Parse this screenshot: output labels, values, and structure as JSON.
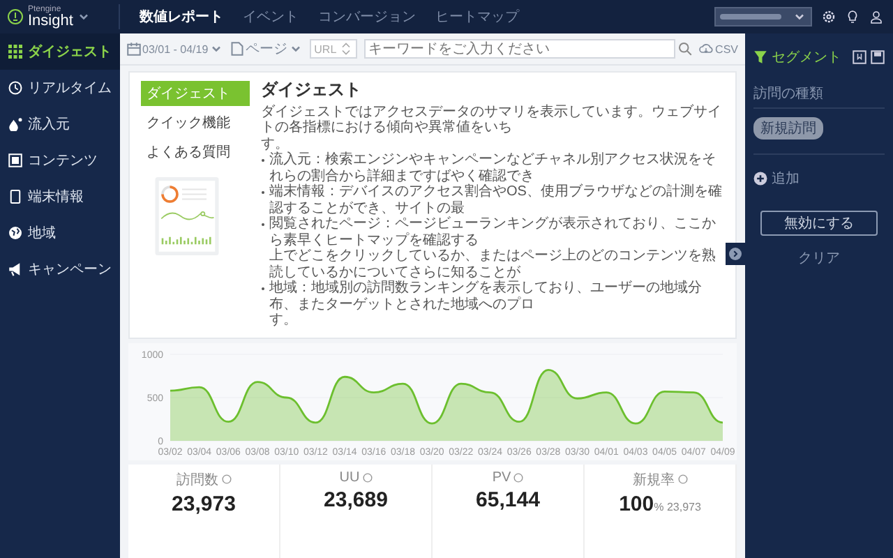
{
  "header": {
    "logo_small": "Ptengine",
    "logo": "Insight",
    "tabs": [
      {
        "label": "数値レポート",
        "selected": true
      },
      {
        "label": "イベント",
        "selected": false
      },
      {
        "label": "コンバージョン",
        "selected": false
      },
      {
        "label": "ヒートマップ",
        "selected": false
      }
    ]
  },
  "sidebar": {
    "items": [
      {
        "label": "ダイジェスト",
        "selected": true
      },
      {
        "label": "リアルタイム",
        "selected": false
      },
      {
        "label": "流入元",
        "selected": false
      },
      {
        "label": "コンテンツ",
        "selected": false
      },
      {
        "label": "端末情報",
        "selected": false
      },
      {
        "label": "地域",
        "selected": false
      },
      {
        "label": "キャンペーン",
        "selected": false
      }
    ]
  },
  "toolbar": {
    "date": "03/01 - 04/19",
    "page_select": "ページ",
    "url_select": "URL",
    "search": {
      "placeholder": "キーワードをご入力ください"
    },
    "csv": "CSV"
  },
  "guide": {
    "menu": [
      {
        "label": "ダイジェスト",
        "selected": true
      },
      {
        "label": "クイック機能",
        "selected": false
      },
      {
        "label": "よくある質問",
        "selected": false
      }
    ],
    "title": "ダイジェスト",
    "intro": "ダイジェストではアクセスデータのサマリを表示しています。ウェブサイトの各指標における傾向や異常値をいち",
    "intro_end": "す。",
    "bullets": [
      {
        "lines": [
          "流入元：検索エンジンやキャンペーンなどチャネル別アクセス状況をそれらの割合から詳細まですばやく確認でき"
        ]
      },
      {
        "lines": [
          "端末情報：デバイスのアクセス割合やOS、使用ブラウザなどの計測を確認することができ、サイトの最"
        ]
      },
      {
        "lines": [
          "閲覧されたページ：ページビューランキングが表示されており、ここから素早くヒートマップを確認する",
          "上でどこをクリックしているか、またはページ上のどのコンテンツを熟読しているかについてさらに知ることが"
        ]
      },
      {
        "lines": [
          "地域：地域別の訪問数ランキングを表示しており、ユーザーの地域分布、またターゲットとされた地域へのプロ",
          "す。"
        ]
      }
    ]
  },
  "chart": {
    "chart_data": {
      "type": "area",
      "categories": [
        "03/02",
        "03/04",
        "03/06",
        "03/08",
        "03/10",
        "03/12",
        "03/14",
        "03/16",
        "03/18",
        "03/20",
        "03/22",
        "03/24",
        "03/26",
        "03/28",
        "03/30",
        "04/01",
        "04/03",
        "04/05",
        "04/07",
        "04/09"
      ],
      "series": [
        {
          "color": "#6cbf2e",
          "values": [
            580,
            620,
            220,
            680,
            500,
            210,
            740,
            560,
            660,
            200,
            660,
            560,
            220,
            820,
            490,
            560,
            200,
            570,
            560,
            210
          ]
        }
      ],
      "ylim": [
        0,
        1000
      ],
      "yticks": [
        0,
        500,
        1000
      ]
    }
  },
  "stats": [
    {
      "label": "訪問数",
      "value": "23,973"
    },
    {
      "label": "UU",
      "value": "23,689"
    },
    {
      "label": "PV",
      "value": "65,144"
    },
    {
      "label": "新規率",
      "value": "100",
      "unit": "%",
      "sub": "23,973"
    }
  ],
  "segment": {
    "title": "セグメント",
    "section": "訪問の種類",
    "chip": "新規訪問",
    "add": "追加",
    "disable": "無効にする",
    "clear": "クリア"
  }
}
